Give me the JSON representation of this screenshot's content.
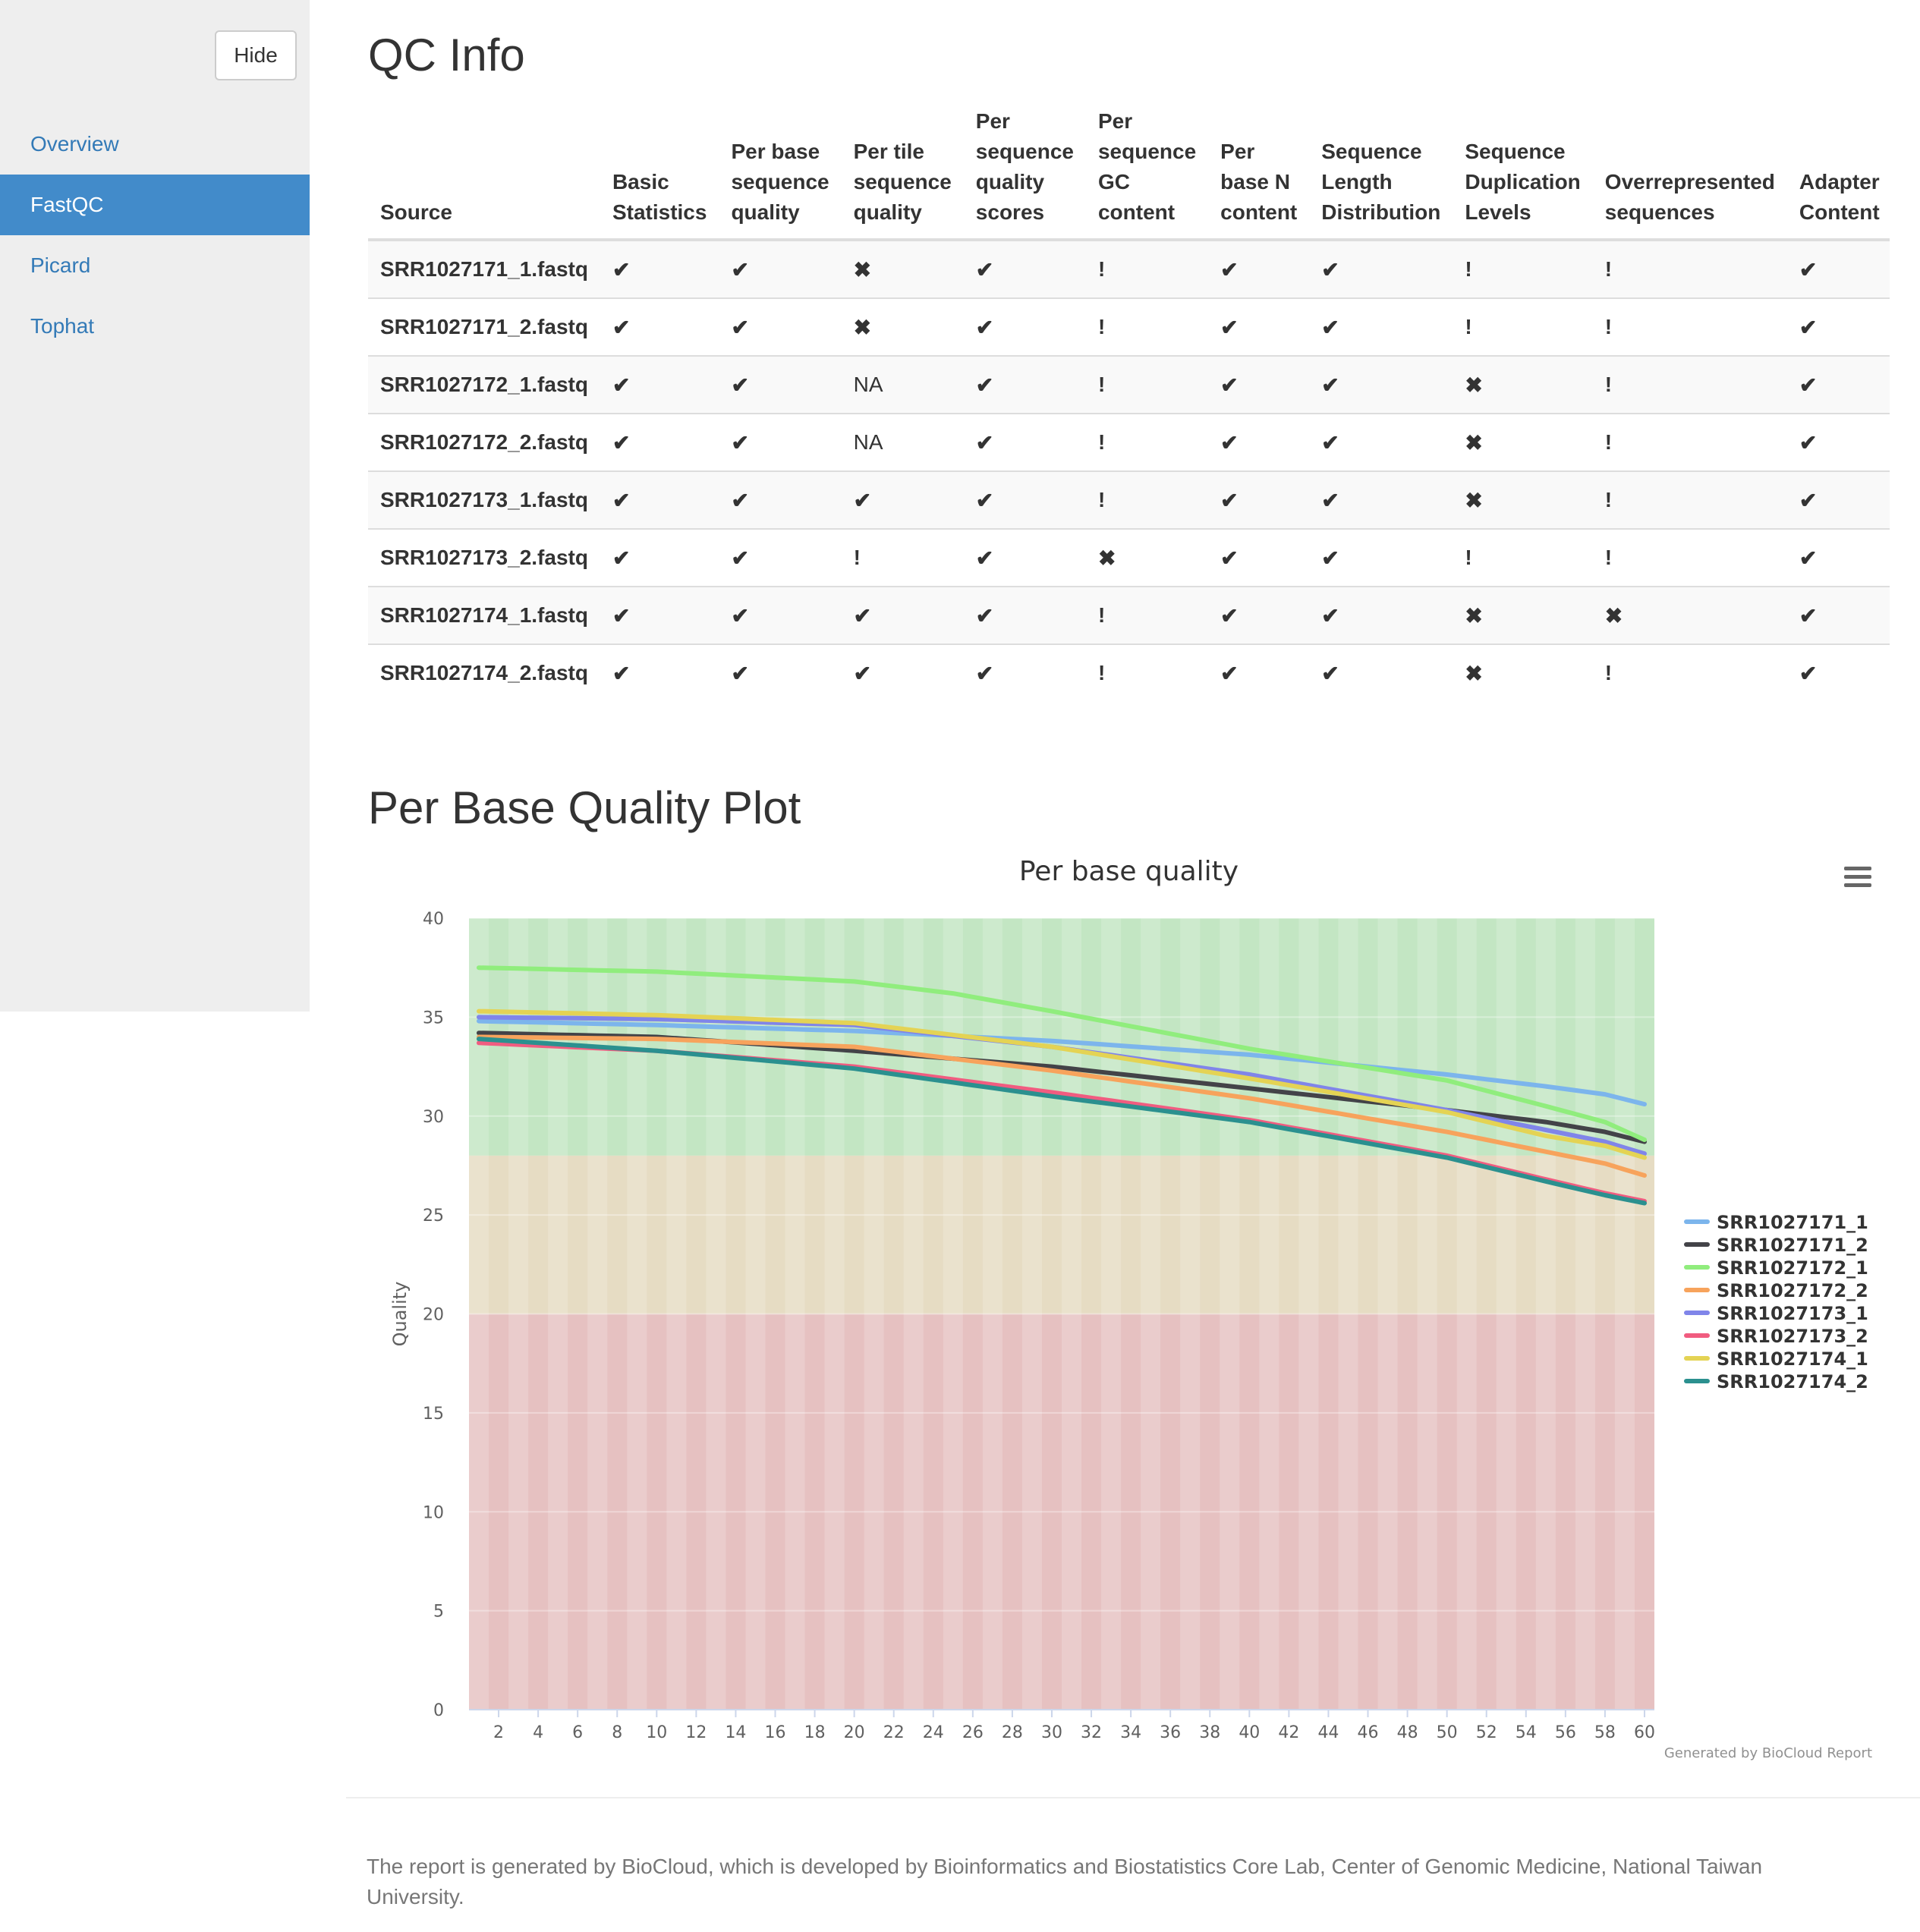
{
  "sidebar": {
    "hide_label": "Hide",
    "items": [
      {
        "label": "Overview",
        "active": false
      },
      {
        "label": "FastQC",
        "active": true
      },
      {
        "label": "Picard",
        "active": false
      },
      {
        "label": "Tophat",
        "active": false
      }
    ]
  },
  "qc_info": {
    "title": "QC Info",
    "columns": [
      "Source",
      "Basic\nStatistics",
      "Per base\nsequence\nquality",
      "Per tile\nsequence\nquality",
      "Per\nsequence\nquality\nscores",
      "Per\nsequence\nGC\ncontent",
      "Per\nbase N\ncontent",
      "Sequence\nLength\nDistribution",
      "Sequence\nDuplication\nLevels",
      "Overrepresented\nsequences",
      "Adapter\nContent"
    ],
    "rows": [
      {
        "source": "SRR1027171_1.fastq",
        "status": [
          "pass",
          "pass",
          "fail",
          "pass",
          "warn",
          "pass",
          "pass",
          "warn",
          "warn",
          "pass"
        ]
      },
      {
        "source": "SRR1027171_2.fastq",
        "status": [
          "pass",
          "pass",
          "fail",
          "pass",
          "warn",
          "pass",
          "pass",
          "warn",
          "warn",
          "pass"
        ]
      },
      {
        "source": "SRR1027172_1.fastq",
        "status": [
          "pass",
          "pass",
          "NA",
          "pass",
          "warn",
          "pass",
          "pass",
          "fail",
          "warn",
          "pass"
        ]
      },
      {
        "source": "SRR1027172_2.fastq",
        "status": [
          "pass",
          "pass",
          "NA",
          "pass",
          "warn",
          "pass",
          "pass",
          "fail",
          "warn",
          "pass"
        ]
      },
      {
        "source": "SRR1027173_1.fastq",
        "status": [
          "pass",
          "pass",
          "pass",
          "pass",
          "warn",
          "pass",
          "pass",
          "fail",
          "warn",
          "pass"
        ]
      },
      {
        "source": "SRR1027173_2.fastq",
        "status": [
          "pass",
          "pass",
          "warn",
          "pass",
          "fail",
          "pass",
          "pass",
          "warn",
          "warn",
          "pass"
        ]
      },
      {
        "source": "SRR1027174_1.fastq",
        "status": [
          "pass",
          "pass",
          "pass",
          "pass",
          "warn",
          "pass",
          "pass",
          "fail",
          "fail",
          "pass"
        ]
      },
      {
        "source": "SRR1027174_2.fastq",
        "status": [
          "pass",
          "pass",
          "pass",
          "pass",
          "warn",
          "pass",
          "pass",
          "fail",
          "warn",
          "pass"
        ]
      }
    ],
    "symbols": {
      "pass": "✔",
      "fail": "✖",
      "warn": "!",
      "NA": "NA"
    },
    "scroll_fraction": 0.91
  },
  "plot_section": {
    "title": "Per Base Quality Plot"
  },
  "chart_data": {
    "type": "line",
    "title": "Per base quality",
    "xlabel": "",
    "ylabel": "Quality",
    "xlim": [
      1,
      60
    ],
    "ylim": [
      0,
      40
    ],
    "y_ticks": [
      0,
      5,
      10,
      15,
      20,
      25,
      30,
      35,
      40
    ],
    "x_ticks": [
      2,
      4,
      6,
      8,
      10,
      12,
      14,
      16,
      18,
      20,
      22,
      24,
      26,
      28,
      30,
      32,
      34,
      36,
      38,
      40,
      42,
      44,
      46,
      48,
      50,
      52,
      54,
      56,
      58,
      60
    ],
    "bands": [
      {
        "from": 28,
        "to": 40,
        "color": "#c3e6c3"
      },
      {
        "from": 20,
        "to": 28,
        "color": "#e6dcc3"
      },
      {
        "from": 0,
        "to": 20,
        "color": "#e6c1c1"
      }
    ],
    "legend_position": "right",
    "credits": "Generated by BioCloud Report",
    "series": [
      {
        "name": "SRR1027171_1",
        "color": "#7cb5ec",
        "x": [
          1,
          10,
          20,
          30,
          40,
          50,
          55,
          58,
          60
        ],
        "values": [
          34.8,
          34.6,
          34.3,
          33.8,
          33.1,
          32.1,
          31.5,
          31.1,
          30.6
        ]
      },
      {
        "name": "SRR1027171_2",
        "color": "#434348",
        "x": [
          1,
          10,
          20,
          30,
          40,
          50,
          55,
          58,
          60
        ],
        "values": [
          34.2,
          34.0,
          33.3,
          32.5,
          31.4,
          30.3,
          29.7,
          29.2,
          28.7
        ]
      },
      {
        "name": "SRR1027172_1",
        "color": "#90ed7d",
        "x": [
          1,
          10,
          20,
          25,
          30,
          40,
          50,
          55,
          58,
          60
        ],
        "values": [
          37.5,
          37.3,
          36.8,
          36.2,
          35.3,
          33.4,
          31.8,
          30.5,
          29.7,
          28.8
        ]
      },
      {
        "name": "SRR1027172_2",
        "color": "#f7a35c",
        "x": [
          1,
          10,
          20,
          30,
          40,
          50,
          55,
          58,
          60
        ],
        "values": [
          34.0,
          33.9,
          33.5,
          32.3,
          30.9,
          29.2,
          28.2,
          27.6,
          27.0
        ]
      },
      {
        "name": "SRR1027173_1",
        "color": "#8085e9",
        "x": [
          1,
          10,
          20,
          30,
          40,
          50,
          55,
          58,
          60
        ],
        "values": [
          35.0,
          34.9,
          34.6,
          33.5,
          32.1,
          30.3,
          29.3,
          28.7,
          28.1
        ]
      },
      {
        "name": "SRR1027173_2",
        "color": "#f15c80",
        "x": [
          1,
          10,
          20,
          30,
          40,
          50,
          55,
          58,
          60
        ],
        "values": [
          33.7,
          33.3,
          32.5,
          31.2,
          29.8,
          28.0,
          26.8,
          26.1,
          25.7
        ]
      },
      {
        "name": "SRR1027174_1",
        "color": "#e4d354",
        "x": [
          1,
          10,
          20,
          30,
          40,
          50,
          55,
          58,
          60
        ],
        "values": [
          35.3,
          35.1,
          34.7,
          33.5,
          31.9,
          30.2,
          29.0,
          28.5,
          27.9
        ]
      },
      {
        "name": "SRR1027174_2",
        "color": "#2b908f",
        "x": [
          1,
          10,
          20,
          30,
          40,
          50,
          55,
          58,
          60
        ],
        "values": [
          33.9,
          33.3,
          32.4,
          31.0,
          29.7,
          27.9,
          26.7,
          26.0,
          25.6
        ]
      }
    ]
  },
  "footer": {
    "text": "The report is generated by BioCloud, which is developed by Bioinformatics and Biostatistics Core Lab, Center of Genomic Medicine, National Taiwan University."
  }
}
